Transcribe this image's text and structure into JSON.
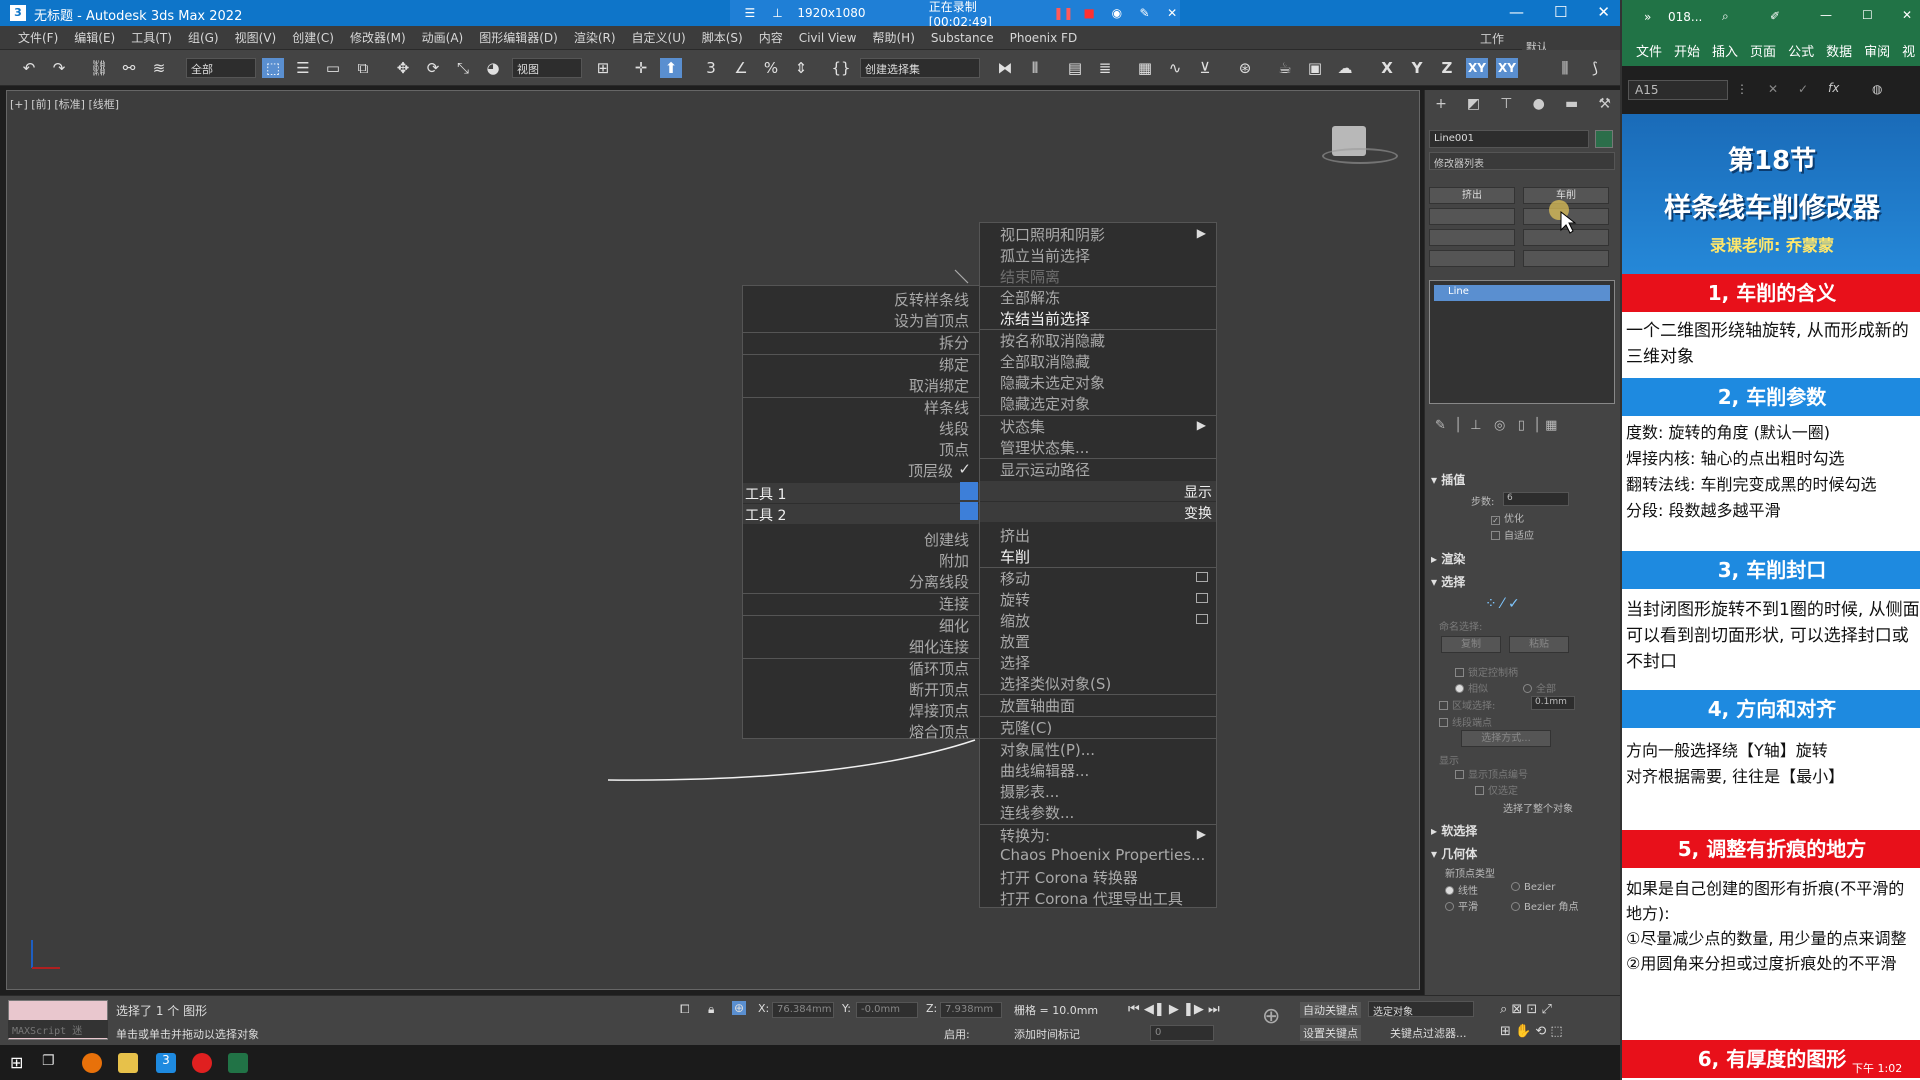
{
  "window": {
    "title": "无标题 - Autodesk 3ds Max 2022",
    "app_icon": "3",
    "recorder_resolution": "1920x1080",
    "recording_status": "正在录制 [00:02:49]"
  },
  "menubar": {
    "items": [
      "文件(F)",
      "编辑(E)",
      "工具(T)",
      "组(G)",
      "视图(V)",
      "创建(C)",
      "修改器(M)",
      "动画(A)",
      "图形编辑器(D)",
      "渲染(R)",
      "自定义(U)",
      "脚本(S)",
      "内容",
      "Civil View",
      "帮助(H)",
      "Substance",
      "Phoenix FD"
    ],
    "workspace_label": "工作区:",
    "workspace_value": "默认"
  },
  "toolbar": {
    "filter_value": "全部",
    "refcoord_value": "视图",
    "selset_value": "创建选择集",
    "axis_x": "X",
    "axis_y": "Y",
    "axis_z": "Z",
    "axis_xy": "XY",
    "axis_xy2": "XY"
  },
  "viewport": {
    "label": "[+] [前] [标准] [线框]"
  },
  "quad_menu": {
    "left_top": [
      "反转样条线",
      "设为首顶点",
      "拆分",
      "绑定",
      "取消绑定",
      "样条线",
      "线段",
      "顶点",
      "顶层级"
    ],
    "top_level_check": "✓",
    "tools1": "工具 1",
    "tools2": "工具 2",
    "display": "显示",
    "transform": "变换",
    "left_bottom": [
      "创建线",
      "附加",
      "分离线段",
      "连接",
      "细化",
      "细化连接",
      "循环顶点",
      "断开顶点",
      "焊接顶点",
      "熔合顶点"
    ],
    "right_top": [
      "视口照明和阴影",
      "孤立当前选择",
      "结束隔离",
      "全部解冻",
      "冻结当前选择",
      "按名称取消隐藏",
      "全部取消隐藏",
      "隐藏未选定对象",
      "隐藏选定对象",
      "状态集",
      "管理状态集...",
      "显示运动路径"
    ],
    "right_bottom": [
      "挤出",
      "车削",
      "移动",
      "旋转",
      "缩放",
      "放置",
      "选择",
      "选择类似对象(S)",
      "放置轴曲面",
      "克隆(C)",
      "对象属性(P)...",
      "曲线编辑器...",
      "摄影表...",
      "连线参数...",
      "转换为:",
      "Chaos Phoenix Properties...",
      "打开 Corona 转换器",
      "打开 Corona 代理导出工具"
    ]
  },
  "command_panel": {
    "object_name": "Line001",
    "modifier_list": "修改器列表",
    "btn_extrude": "挤出",
    "btn_lathe": "车削",
    "stack_item": "Line",
    "roll_interp": "插值",
    "steps_label": "步数:",
    "steps_value": "6",
    "optimize": "优化",
    "adaptive": "自适应",
    "roll_render": "渲染",
    "roll_select": "选择",
    "named_sel": "命名选择:",
    "copy": "复制",
    "paste": "粘贴",
    "lock_handles": "锁定控制柄",
    "similar": "相似",
    "all": "全部",
    "area_sel": "区域选择:",
    "area_value": "0.1mm",
    "seg_end": "线段端点",
    "sel_method": "选择方式...",
    "display": "显示",
    "show_vnum": "显示顶点编号",
    "sel_only": "仅选定",
    "sel_whole": "选择了整个对象",
    "roll_soft": "软选择",
    "roll_geom": "几何体",
    "new_vtype": "新顶点类型",
    "linear": "线性",
    "bezier": "Bezier",
    "smooth": "平滑",
    "bezier_corner": "Bezier 角点"
  },
  "statusbar": {
    "maxscript": "MAXScript 迷",
    "selected": "选择了 1 个 图形",
    "hint": "单击或单击并拖动以选择对象",
    "x_label": "X:",
    "x_value": "76.384mm",
    "y_label": "Y:",
    "y_value": "-0.0mm",
    "z_label": "Z:",
    "z_value": "7.938mm",
    "grid": "栅格 = 10.0mm",
    "auto_key": "自动关键点",
    "set_key": "设置关键点",
    "selected_obj": "选定对象",
    "key_filters": "关键点过滤器...",
    "enable": "启用:",
    "add_time_tag": "添加时间标记",
    "frame": "0"
  },
  "excel": {
    "title": "018...",
    "tabs": [
      "文件",
      "开始",
      "插入",
      "页面",
      "公式",
      "数据",
      "审阅",
      "视"
    ],
    "namebox": "A15",
    "banner_line1": "第18节",
    "banner_line2": "样条线车削修改器",
    "banner_line3": "录课老师: 乔蒙蒙",
    "sec1": "1, 车削的含义",
    "sec1_body": "一个二维图形绕轴旋转, 从而形成新的三维对象",
    "sec2": "2, 车削参数",
    "sec2_body": "度数: 旋转的角度 (默认一圈)\n焊接内核: 轴心的点出粗时勾选\n翻转法线: 车削完变成黑的时候勾选\n分段: 段数越多越平滑",
    "sec3": "3, 车削封口",
    "sec3_body": "当封闭图形旋转不到1圈的时候, 从侧面可以看到剖切面形状, 可以选择封口或不封口",
    "sec4": "4, 方向和对齐",
    "sec4_body": "方向一般选择绕【Y轴】旋转\n对齐根据需要, 往往是【最小】",
    "sec5": "5, 调整有折痕的地方",
    "sec5_body": "如果是自己创建的图形有折痕(不平滑的地方):\n①尽量减少点的数量, 用少量的点来调整\n②用圆角来分担或过度折痕处的不平滑",
    "sec6": "6, 有厚度的图形",
    "clock": "下午 1:02"
  }
}
